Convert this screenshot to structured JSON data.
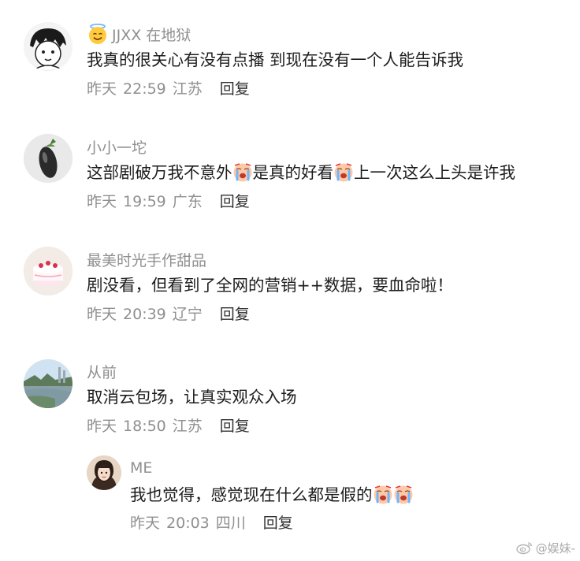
{
  "comments": [
    {
      "user": "JJXX 在地狱",
      "body": "我真的很关心有没有点播  到现在没有一个人能告诉我",
      "date": "昨天",
      "time": "22:59",
      "location": "江苏",
      "reply": "回复"
    },
    {
      "user": "小小一坨",
      "body_parts": [
        "这部剧破万我不意外",
        "是真的好看",
        "上一次这么上头是许我"
      ],
      "date": "昨天",
      "time": "19:59",
      "location": "广东",
      "reply": "回复"
    },
    {
      "user": "最美时光手作甜品",
      "body": "剧没看，但看到了全网的营销++数据，要血命啦！",
      "date": "昨天",
      "time": "20:39",
      "location": "辽宁",
      "reply": "回复"
    },
    {
      "user": "从前",
      "body": "取消云包场，让真实观众入场",
      "date": "昨天",
      "time": "18:50",
      "location": "江苏",
      "reply": "回复"
    }
  ],
  "reply_comment": {
    "user": "ME",
    "body": "我也觉得，感觉现在什么都是假的",
    "date": "昨天",
    "time": "20:03",
    "location": "四川",
    "reply": "回复"
  },
  "watermark": {
    "text": "@娱妹-"
  },
  "icons": {
    "halo_badge": "smiling-face-with-halo-icon",
    "crying_emoji": "loudly-crying-face-icon",
    "weibo_logo": "weibo-logo-icon"
  },
  "colors": {
    "meta_gray": "#8f8f8f",
    "body_text": "#1c1c1c",
    "reply_text": "#303030"
  }
}
